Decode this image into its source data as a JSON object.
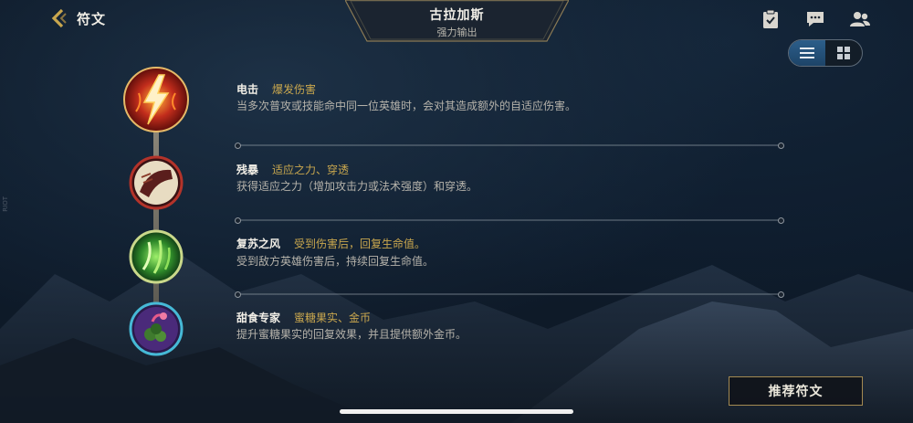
{
  "header": {
    "back_title": "符文",
    "hero_name": "古拉加斯",
    "hero_role": "强力输出"
  },
  "icons": {
    "back": "chevron-left-icon",
    "tasks": "clipboard-check-icon",
    "chat": "chat-bubble-icon",
    "friends": "friends-icon",
    "list_view": "list-view-icon",
    "grid_view": "grid-view-icon"
  },
  "view_toggle": {
    "active": "list"
  },
  "runes": [
    {
      "name": "电击",
      "tag": "爆发伤害",
      "desc": "当多次普攻或技能命中同一位英雄时，会对其造成额外的自适应伤害。",
      "icon": "electrocute-icon",
      "ring": "#b3332a"
    },
    {
      "name": "残暴",
      "tag": "适应之力、穿透",
      "desc": "获得适应之力（增加攻击力或法术强度）和穿透。",
      "icon": "brutal-icon",
      "ring": "#b3332a"
    },
    {
      "name": "复苏之风",
      "tag": "受到伤害后，回复生命值。",
      "desc": "受到敌方英雄伤害后，持续回复生命值。",
      "icon": "revitalize-wind-icon",
      "ring": "#9fbf5a"
    },
    {
      "name": "甜食专家",
      "tag": "蜜糖果实、金币",
      "desc": "提升蜜糖果实的回复效果，并且提供额外金币。",
      "icon": "sweet-tooth-icon",
      "ring": "#46b9d6"
    }
  ],
  "footer": {
    "recommend_label": "推荐符文"
  },
  "side_mark": "RIOT"
}
